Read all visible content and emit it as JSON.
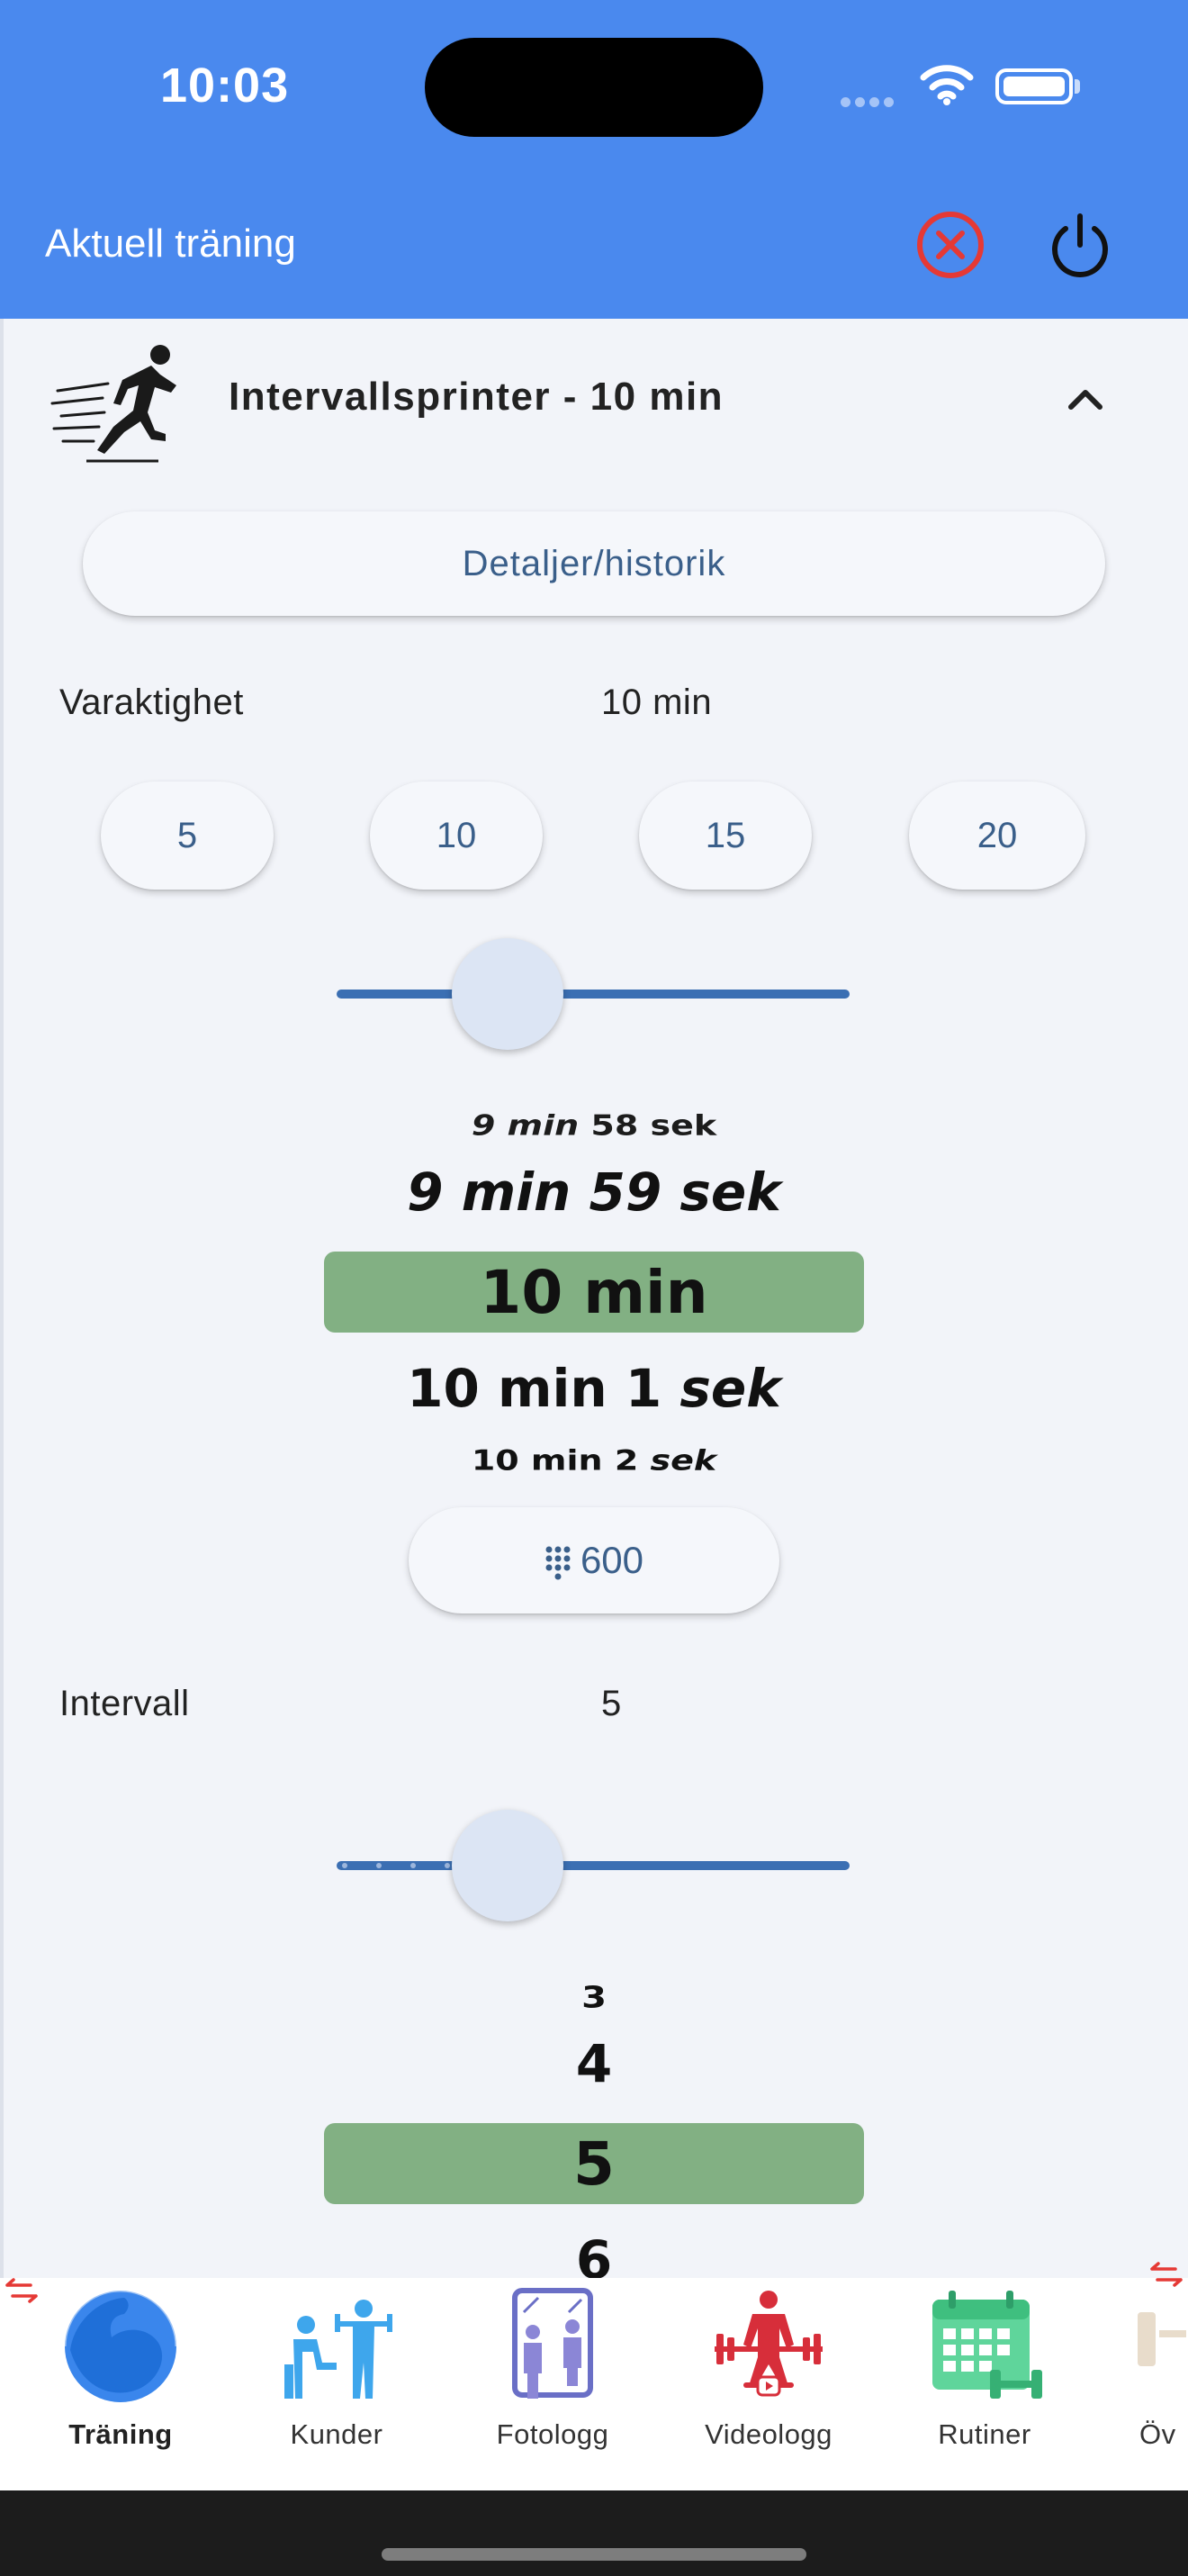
{
  "status_bar": {
    "time": "10:03"
  },
  "app_bar": {
    "title": "Aktuell träning",
    "close_icon": "close-circle-icon",
    "power_icon": "power-icon",
    "accent": "#4a89ee",
    "close_color": "#e53935"
  },
  "exercise": {
    "title": "Intervallsprinter - 10 min",
    "icon": "sprinter-icon",
    "details_label": "Detaljer/historik"
  },
  "duration": {
    "label": "Varaktighet",
    "value": "10 min",
    "presets": [
      "5",
      "10",
      "15",
      "20"
    ],
    "slider_level": 10,
    "wheel": {
      "w0": {
        "prefix": "9 min",
        "suffix": "58 sek"
      },
      "w1": "9 min 59 sek",
      "selected": "10 min",
      "w3": {
        "prefix": "10 min 1",
        "suffix": "sek"
      },
      "w4": {
        "prefix": "10 min 2",
        "suffix": "sek"
      }
    },
    "keypad_value": "600"
  },
  "interval": {
    "label": "Intervall",
    "value": "5",
    "wheel": [
      "3",
      "4",
      "5",
      "6"
    ],
    "selected_index": 2
  },
  "wheel_highlight_color": "#82b083",
  "bottom_nav": {
    "items": [
      {
        "label": "Träning",
        "icon": "flexed-arm-icon"
      },
      {
        "label": "Kunder",
        "icon": "trainer-client-icon"
      },
      {
        "label": "Fotologg",
        "icon": "mirror-photo-icon"
      },
      {
        "label": "Videologg",
        "icon": "weightlifter-video-icon"
      },
      {
        "label": "Rutiner",
        "icon": "calendar-dumbbell-icon"
      },
      {
        "label": "Öv",
        "icon": "exercise-icon"
      }
    ]
  }
}
